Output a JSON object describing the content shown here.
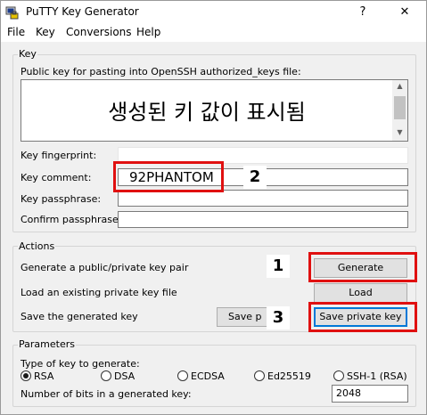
{
  "window": {
    "title": "PuTTY Key Generator",
    "help_glyph": "?",
    "close_glyph": "✕"
  },
  "menu": [
    "File",
    "Key",
    "Conversions",
    "Help"
  ],
  "key_group": {
    "label": "Key",
    "pubkey_label": "Public key for pasting into OpenSSH authorized_keys file:",
    "pubkey_overlay_text": "생성된 키 값이 표시됨",
    "fingerprint_label": "Key fingerprint:",
    "fingerprint_value": "",
    "comment_label": "Key comment:",
    "comment_value": "92PHANTOM",
    "passphrase_label": "Key passphrase:",
    "passphrase_value": "",
    "confirm_label": "Confirm passphrase:",
    "confirm_value": ""
  },
  "actions_group": {
    "label": "Actions",
    "generate_label": "Generate a public/private key pair",
    "generate_button": "Generate",
    "load_label": "Load an existing private key file",
    "load_button": "Load",
    "save_label": "Save the generated key",
    "save_public_button": "Save p",
    "save_private_button": "Save private key"
  },
  "params_group": {
    "label": "Parameters",
    "type_label": "Type of key to generate:",
    "key_types": [
      "RSA",
      "DSA",
      "ECDSA",
      "Ed25519",
      "SSH-1 (RSA)"
    ],
    "selected_type": "RSA",
    "bits_label": "Number of bits in a generated key:",
    "bits_value": "2048"
  },
  "annotations": [
    "1",
    "2",
    "3"
  ],
  "colors": {
    "highlight": "#e01010",
    "focus": "#0078d7"
  }
}
